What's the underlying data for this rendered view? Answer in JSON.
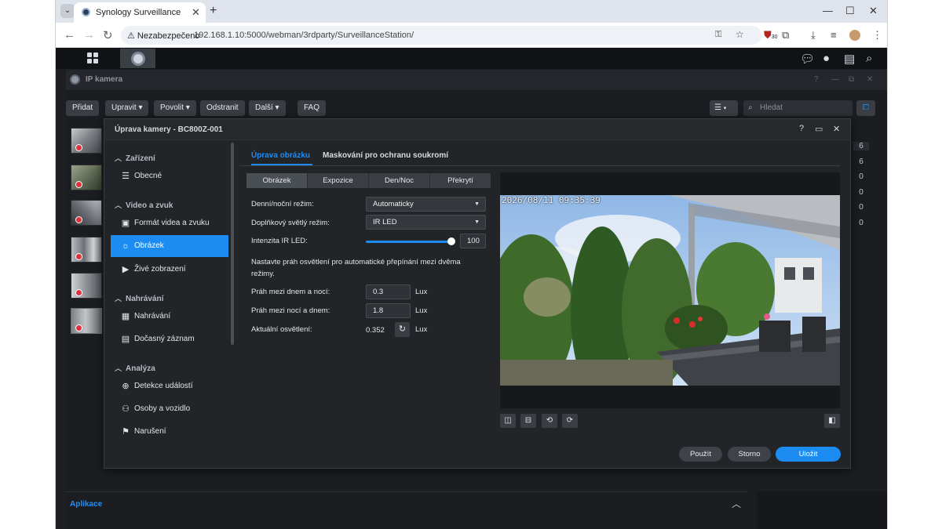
{
  "browser": {
    "tab_title": "Synology Surveillance Station -",
    "security_label": "Nezabezpečeno",
    "url": "192.168.1.10:5000/webman/3rdparty/SurveillanceStation/",
    "ext_badge": "30"
  },
  "ipcam_window": {
    "title": "IP kamera",
    "toolbar": [
      "Přidat",
      "Upravit ▾",
      "Povolit ▾",
      "Odstranit",
      "Další ▾",
      "FAQ"
    ],
    "search_placeholder": "Hledat",
    "counts": [
      "6",
      "6",
      "0",
      "0",
      "0",
      "0"
    ],
    "footer_label": "Aplikace"
  },
  "modal": {
    "title": "Úprava kamery - BC800Z-001",
    "sidebar": {
      "sections": [
        {
          "label": "Zařízení",
          "items": [
            {
              "label": "Obecné",
              "icon": "list-icon"
            }
          ]
        },
        {
          "label": "Video a zvuk",
          "items": [
            {
              "label": "Formát videa a zvuku",
              "icon": "film-icon"
            },
            {
              "label": "Obrázek",
              "icon": "sun-icon"
            },
            {
              "label": "Živé zobrazení",
              "icon": "play-icon"
            }
          ]
        },
        {
          "label": "Nahrávání",
          "items": [
            {
              "label": "Nahrávání",
              "icon": "calendar-icon"
            },
            {
              "label": "Dočasný záznam",
              "icon": "sd-card-icon"
            }
          ]
        },
        {
          "label": "Analýza",
          "items": [
            {
              "label": "Detekce událostí",
              "icon": "crosshair-icon"
            },
            {
              "label": "Osoby a vozidlo",
              "icon": "person-vehicle-icon"
            },
            {
              "label": "Narušení",
              "icon": "walker-icon"
            }
          ]
        }
      ],
      "active": "Obrázek"
    },
    "tabs": [
      "Úprava obrázku",
      "Maskování pro ochranu soukromí"
    ],
    "subtabs": [
      "Obrázek",
      "Expozice",
      "Den/Noc",
      "Překrytí"
    ],
    "fields": {
      "day_night_label": "Denní/noční režim:",
      "day_night_value": "Automaticky",
      "aux_light_label": "Doplňkový světlý režim:",
      "aux_light_value": "IR LED",
      "ir_label": "Intenzita IR LED:",
      "ir_value": "100",
      "ir_level": 1.0,
      "threshold_desc": "Nastavte práh osvětlení pro automatické přepínání mezi dvěma režimy.",
      "day_to_night_label": "Práh mezi dnem a nocí:",
      "day_to_night_value": "0.3",
      "night_to_day_label": "Práh mezi nocí a dnem:",
      "night_to_day_value": "1.8",
      "current_label": "Aktuální osvětlení:",
      "current_value": "0.352",
      "unit": "Lux"
    },
    "preview_timestamp": "2026/08/11 09:35:39",
    "buttons": {
      "apply": "Použít",
      "cancel": "Storno",
      "save": "Uložit"
    }
  }
}
